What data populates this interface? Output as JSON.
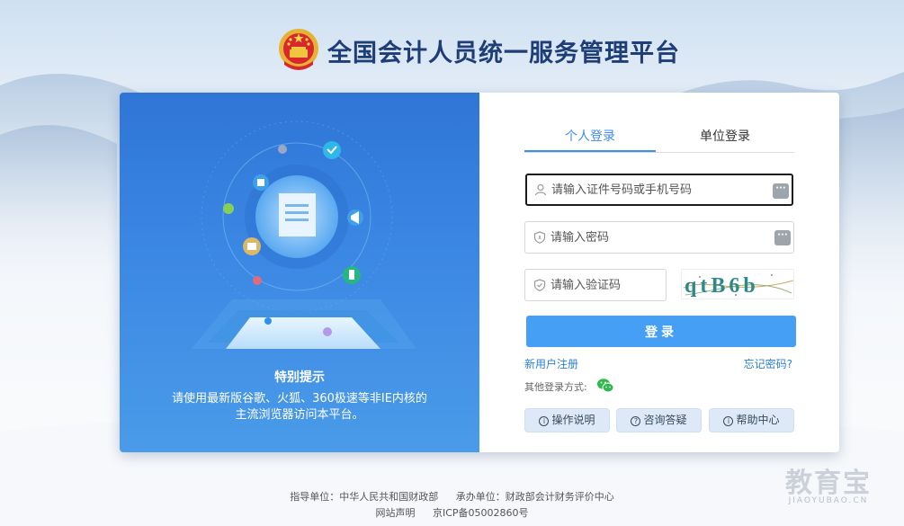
{
  "header": {
    "title": "全国会计人员统一服务管理平台",
    "emblem_icon": "national-emblem-icon"
  },
  "left_panel": {
    "notice_title": "特别提示",
    "notice_line1": "请使用最新版谷歌、火狐、360极速等非IE内核的",
    "notice_line2": "主流浏览器访问本平台。"
  },
  "login": {
    "tabs": [
      {
        "label": "个人登录",
        "active": true
      },
      {
        "label": "单位登录",
        "active": false
      }
    ],
    "username_placeholder": "请输入证件号码或手机号码",
    "password_placeholder": "请输入密码",
    "captcha_placeholder": "请输入验证码",
    "captcha_text": "qtB6b",
    "more_icon": "···",
    "submit_label": "登录",
    "register_label": "新用户注册",
    "forgot_label": "忘记密码?",
    "other_methods_label": "其他登录方式:",
    "other_methods_icon": "wechat-icon",
    "help_buttons": [
      {
        "icon": "info-icon",
        "label": "操作说明"
      },
      {
        "icon": "question-icon",
        "label": "咨询答疑"
      },
      {
        "icon": "info-icon",
        "label": "帮助中心"
      }
    ],
    "accent_color": "#45a0f5"
  },
  "footer": {
    "guide_unit": "指导单位：中华人民共和国财政部",
    "host_unit": "承办单位：财政部会计财务评价中心",
    "statement": "网站声明",
    "icp": "京ICP备05002860号"
  },
  "watermark": {
    "main": "教育宝",
    "sub": "JIAOYUBAO.CN"
  }
}
